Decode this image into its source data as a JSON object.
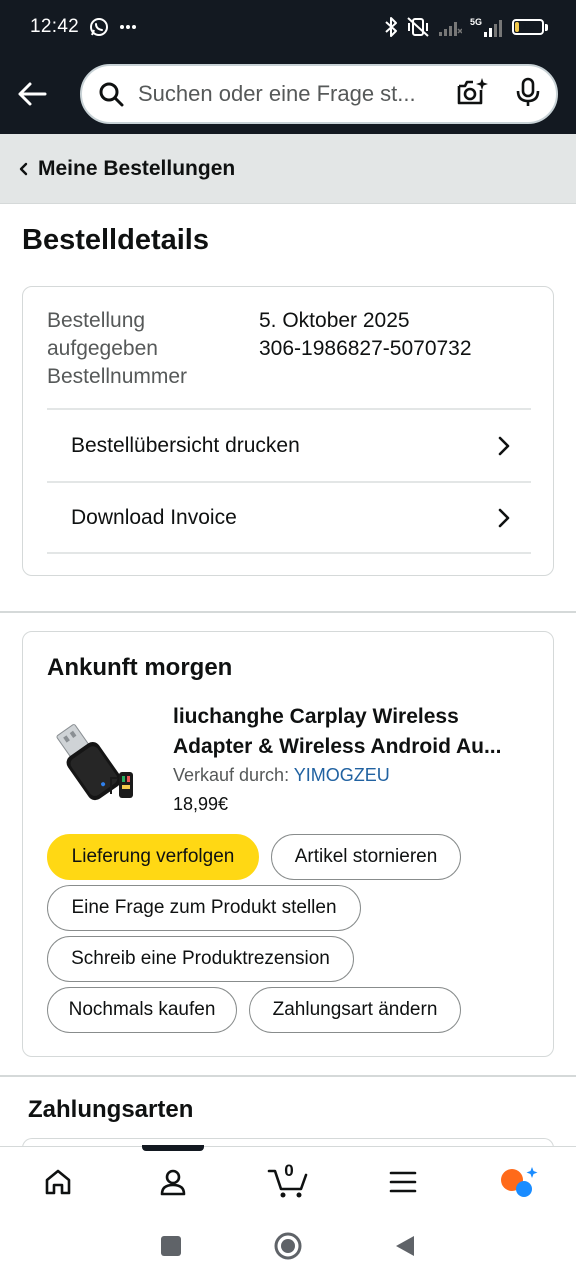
{
  "status_bar": {
    "time": "12:42",
    "battery_level": "15",
    "battery_fraction": 0.15,
    "network": "5G",
    "icons": [
      "whatsapp-icon",
      "more-dots-icon",
      "bluetooth-icon",
      "vibrate-off-icon",
      "signal-icon",
      "signal-5g-icon",
      "battery-icon"
    ]
  },
  "search": {
    "placeholder": "Suchen oder eine Frage st..."
  },
  "breadcrumb": {
    "label": "Meine Bestellungen"
  },
  "page": {
    "title": "Bestelldetails"
  },
  "order": {
    "labels": [
      "Bestellung",
      "aufgegeben",
      "Bestellnummer"
    ],
    "date": "5. Oktober 2025",
    "number": "306-1986827-5070732",
    "links": [
      {
        "label": "Bestellübersicht drucken"
      },
      {
        "label": "Download Invoice"
      }
    ]
  },
  "shipment": {
    "title": "Ankunft morgen",
    "product": {
      "name_line1": "liuchanghe Carplay Wireless",
      "name_line2": "Adapter & Wireless Android Au...",
      "seller_label": "Verkauf durch: ",
      "seller_name": "YIMOGZEU",
      "price": "18,99€"
    },
    "buttons": {
      "track": "Lieferung verfolgen",
      "cancel": "Artikel stornieren",
      "question": "Eine Frage zum Produkt stellen",
      "review": "Schreib eine Produktrezension",
      "buy_again": "Nochmals kaufen",
      "change_payment": "Zahlungsart ändern"
    }
  },
  "payment": {
    "title": "Zahlungsarten"
  },
  "bottom_nav": {
    "cart_count": "0",
    "items": [
      "home-icon",
      "account-icon",
      "cart-icon",
      "menu-icon",
      "rufus-icon"
    ],
    "active": "account-icon"
  },
  "colors": {
    "header_bg": "#131921",
    "primary_button": "#ffd814",
    "link": "#2162a1",
    "ai_orange": "#ff6a1a",
    "ai_blue": "#1a8cff"
  }
}
